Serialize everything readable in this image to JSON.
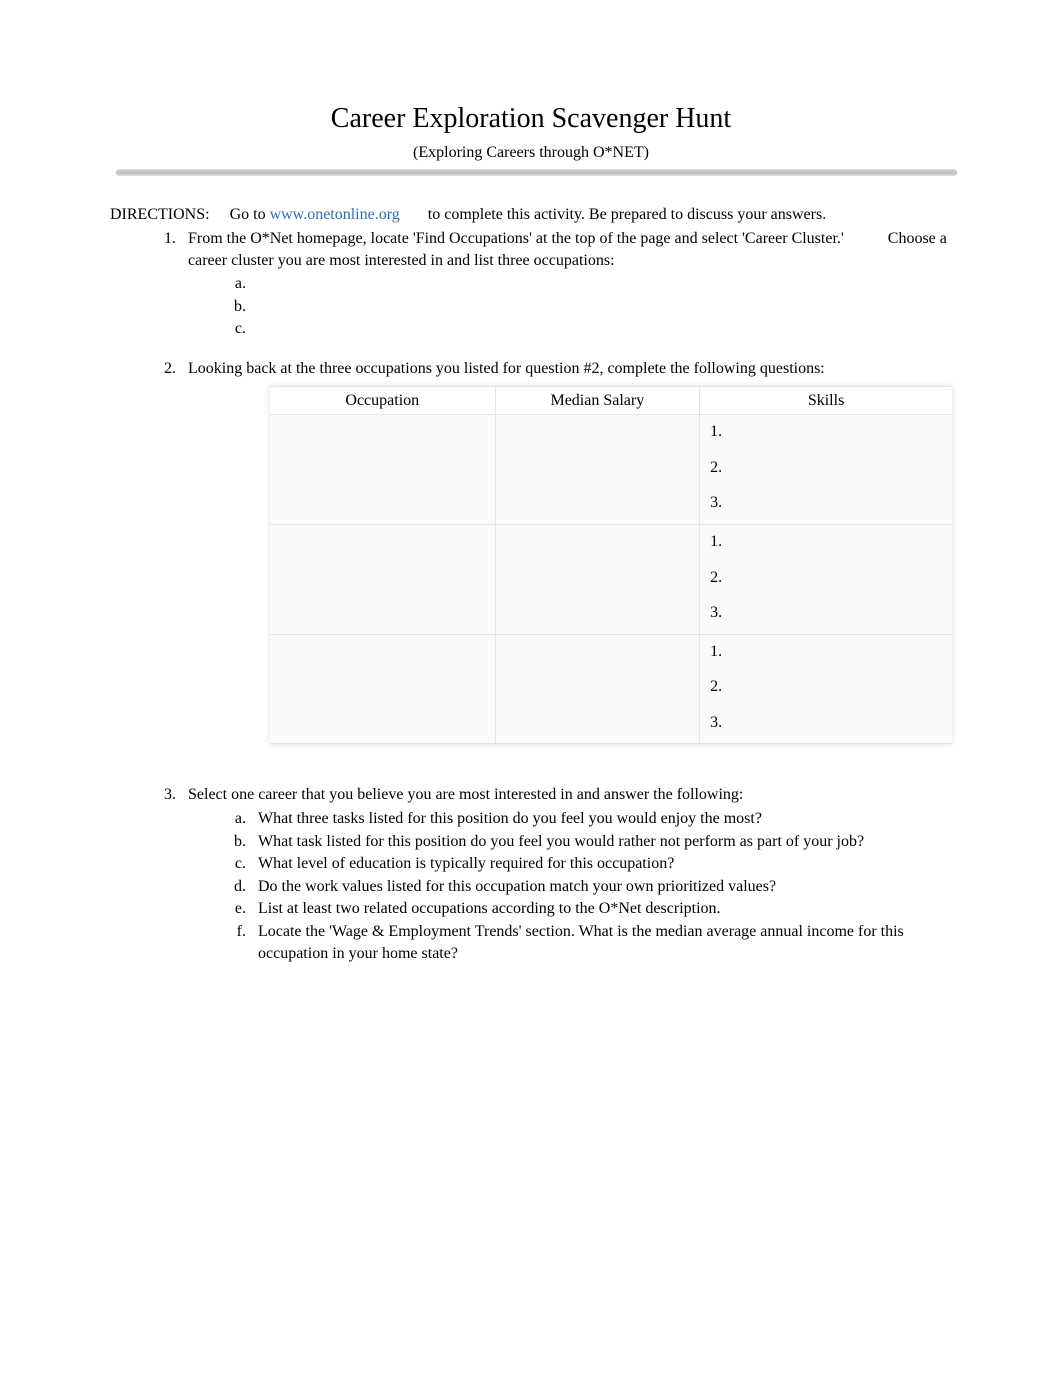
{
  "title": "Career Exploration Scavenger Hunt",
  "subtitle": "(Exploring Careers through O*NET)",
  "directions": {
    "label": "DIRECTIONS:",
    "go_to": "Go to ",
    "link_text": "www.onetonline.org",
    "tail": " to complete this activity. Be prepared to discuss your answers."
  },
  "questions": {
    "q1": {
      "text_a": "From the O*Net homepage, locate 'Find Occupations' at the top of the page and select 'Career Cluster.'",
      "text_b": "Choose a career cluster you are most interested in and list three occupations:",
      "items": [
        "",
        "",
        ""
      ]
    },
    "q2": {
      "text": "Looking back at the three occupations you listed for question #2, complete the following questions:",
      "table": {
        "headers": [
          "Occupation",
          "Median Salary",
          "Skills"
        ],
        "skill_labels": [
          "1.",
          "2.",
          "3."
        ]
      }
    },
    "q3": {
      "text": "Select one career that you believe you are most interested in and answer the following:",
      "items": [
        "What three tasks listed for this position do you feel you would enjoy the most?",
        "What task listed for this position do you feel you would rather not perform as part of your job?",
        "What level of education is typically required for this occupation?",
        "Do the work values listed for this occupation match your own prioritized values?",
        "List at least two related occupations according to the O*Net description.",
        "Locate the 'Wage & Employment Trends' section. What is the median average annual income for this occupation in your home state?"
      ]
    }
  }
}
